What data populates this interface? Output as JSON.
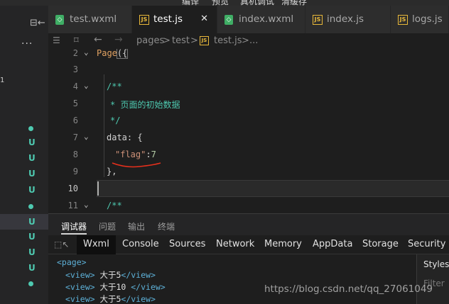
{
  "menubar": {
    "items": [
      "编译",
      "预览",
      "真机调试",
      "清缓存"
    ]
  },
  "sidebar": {
    "split_icon": "split-editor-icon",
    "more": "···",
    "marker": "1",
    "git_status": [
      "U",
      "U",
      "U",
      "U",
      "U",
      "U",
      "U",
      "U"
    ]
  },
  "tabs": [
    {
      "label": "test.wxml",
      "type": "wxml"
    },
    {
      "label": "test.js",
      "type": "js",
      "active": true,
      "close": "✕"
    },
    {
      "label": "index.wxml",
      "type": "wxml"
    },
    {
      "label": "index.js",
      "type": "js"
    },
    {
      "label": "logs.js",
      "type": "js"
    }
  ],
  "breadcrumb": {
    "pages": "pages",
    "sep": ">",
    "folder": "test",
    "file": "test.js",
    "tail": "..."
  },
  "editor": {
    "line_numbers": [
      "2",
      "3",
      "4",
      "5",
      "6",
      "7",
      "8",
      "9",
      "10",
      "11"
    ],
    "current_line": "10",
    "code": {
      "l2_kw": "Page",
      "l2_paren": "({",
      "l4": "/**",
      "l5": "* 页面的初始数据",
      "l6": "*/",
      "l7_key": "data",
      "l7_rest": ": {",
      "l8_str": "\"flag\"",
      "l8_colon": ":",
      "l8_num": "7",
      "l9": "},",
      "l11": "/**"
    }
  },
  "debugger": {
    "tabs": [
      "调试器",
      "问题",
      "输出",
      "终端"
    ],
    "panel_tabs": [
      "Wxml",
      "Console",
      "Sources",
      "Network",
      "Memory",
      "AppData",
      "Storage",
      "Security"
    ],
    "elements": [
      {
        "open": "<page>"
      },
      {
        "open": "<view>",
        "text": " 大于5",
        "close": "</view>"
      },
      {
        "open": "<view>",
        "text": " 大于10 ",
        "close": "</view>"
      },
      {
        "open": "<view>",
        "text": " 大于5",
        "close": "</view>"
      }
    ],
    "styles": {
      "title": "Styles",
      "filter": "Filter"
    }
  },
  "watermark": "https://blog.csdn.net/qq_27061049",
  "colors": {
    "keyword": "#e2a262",
    "comment": "#4ec9b0",
    "string": "#ce9178",
    "number": "#b5cea8",
    "tag": "#5db0d7",
    "annotation": "#e8301c"
  }
}
